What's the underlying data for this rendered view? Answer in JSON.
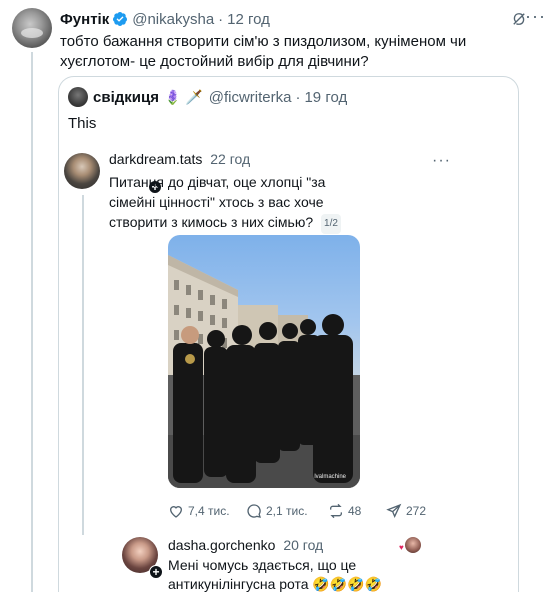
{
  "tweet": {
    "author_name": "Фунтік",
    "author_handle": "@nikakysha",
    "time": "12 год",
    "text": "тобто бажання створити сім'ю з пиздолизом, кунімeном чи хуєглотом- це достойний вибір для дівчини?",
    "more": "···"
  },
  "quote": {
    "author_name": "свідкиця",
    "emojis": "🪻 🗡️",
    "author_handle": "@ficwriterka",
    "time": "19 год",
    "text": "This"
  },
  "threads_post": {
    "author": "darkdream.tats",
    "time": "22 год",
    "more": "···",
    "text": "Питання до дівчат, оце хлопці \"за сімейні цінності\" хтось з вас хоче створити з кимось з них сімью?",
    "pager": "1/2",
    "watermark": "lvalmachine",
    "actions": {
      "likes": "7,4 тис.",
      "replies": "2,1 тис.",
      "reposts": "48",
      "shares": "272"
    }
  },
  "reply": {
    "author": "dasha.gorchenko",
    "time": "20 год",
    "text": "Мені чомусь здається, що це антикунілінгусна рота 🤣🤣🤣🤣"
  },
  "colors": {
    "verified": "#1d9bf0",
    "muted": "#536471",
    "border": "#cfd9de"
  }
}
